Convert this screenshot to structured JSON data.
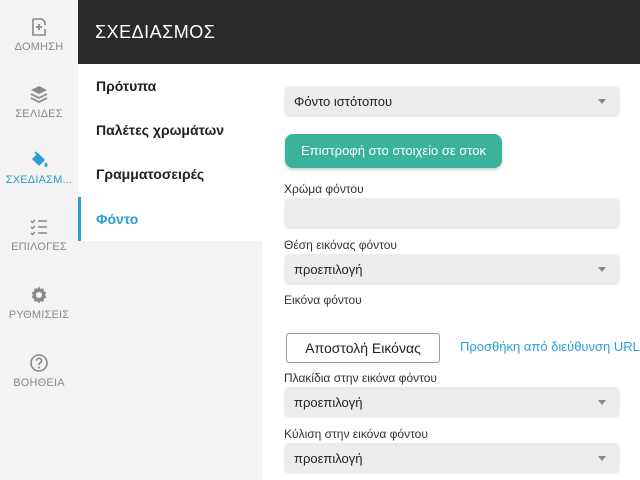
{
  "rail": {
    "items": [
      {
        "label": "ΔΟΜΗΣΗ",
        "icon": "add-box-icon"
      },
      {
        "label": "ΣΕΛΙΔΕΣ",
        "icon": "layers-icon"
      },
      {
        "label": "ΣΧΕΔΙΑΣΜ...",
        "icon": "paint-bucket-icon"
      },
      {
        "label": "ΕΠΙΛΟΓΕΣ",
        "icon": "checklist-icon"
      },
      {
        "label": "ΡΥΘΜΙΣΕΙΣ",
        "icon": "gear-icon"
      },
      {
        "label": "ΒΟΗΘΕΙΑ",
        "icon": "help-circle-icon"
      }
    ],
    "active_index": 2
  },
  "header": {
    "title": "ΣΧΕΔΙΑΣΜΟΣ"
  },
  "subnav": {
    "items": [
      {
        "label": "Πρότυπα"
      },
      {
        "label": "Παλέτες χρωμάτων"
      },
      {
        "label": "Γραμματοσειρές"
      },
      {
        "label": "Φόντο"
      }
    ],
    "active_index": 3
  },
  "content": {
    "background_select": "Φόντο ιστότοπου",
    "revert_button": "Επιστροφή στο στοιχείο σε στοκ",
    "bg_color_label": "Χρώμα φόντου",
    "bg_color_value": "",
    "bg_position_label": "Θέση εικόνας φόντου",
    "bg_position_value": "προεπιλογή",
    "bg_image_label": "Εικόνα φόντου",
    "upload_button": "Αποστολή Εικόνας",
    "add_url_link": "Προσθήκη από διεύθυνση URL",
    "tiles_label": "Πλακίδια στην εικόνα φόντου",
    "tiles_value": "προεπιλογή",
    "scroll_label": "Κύλιση στην εικόνα φόντου",
    "scroll_value": "προεπιλογή"
  },
  "colors": {
    "accent": "#2a9fd6",
    "button_green": "#3bb39b",
    "header_bg": "#2b2b2b"
  }
}
